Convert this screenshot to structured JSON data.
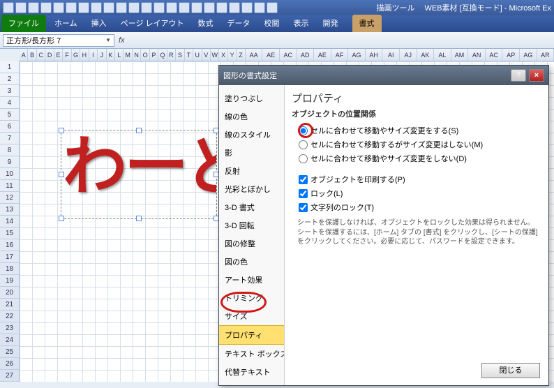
{
  "app": {
    "contextTool": "描画ツール",
    "docTitle": "WEB素材 [互換モード] - Microsoft Ex"
  },
  "tabs": {
    "file": "ファイル",
    "home": "ホーム",
    "insert": "挿入",
    "layout": "ページ レイアウト",
    "formula": "数式",
    "data": "データ",
    "review": "校閲",
    "view": "表示",
    "dev": "開発",
    "format": "書式"
  },
  "namebox": "正方形/長方形 7",
  "fx": "fx",
  "cols": [
    "A",
    "B",
    "C",
    "D",
    "E",
    "F",
    "G",
    "H",
    "I",
    "J",
    "K",
    "L",
    "M",
    "N",
    "O",
    "P",
    "Q",
    "R",
    "S",
    "T",
    "U",
    "V",
    "W",
    "X",
    "Y",
    "Z",
    "AA",
    "AE",
    "AC",
    "AD",
    "AE",
    "AF",
    "AG",
    "AH",
    "AI",
    "AJ",
    "AK",
    "AL",
    "AM",
    "AN",
    "AC",
    "AP",
    "AG",
    "AR"
  ],
  "shapeText": "わーど",
  "dialog": {
    "title": "図形の書式設定",
    "nav": [
      "塗りつぶし",
      "線の色",
      "線のスタイル",
      "影",
      "反射",
      "光彩とぼかし",
      "3-D 書式",
      "3-D 回転",
      "図の修整",
      "図の色",
      "アート効果",
      "トリミング",
      "サイズ",
      "プロパティ",
      "テキスト ボックス",
      "代替テキスト"
    ],
    "activeNav": 13,
    "heading": "プロパティ",
    "subheading": "オブジェクトの位置関係",
    "radios": [
      {
        "label": "セルに合わせて移動やサイズ変更をする(S)",
        "checked": true
      },
      {
        "label": "セルに合わせて移動するがサイズ変更はしない(M)",
        "checked": false
      },
      {
        "label": "セルに合わせて移動やサイズ変更をしない(D)",
        "checked": false
      }
    ],
    "checks": [
      {
        "label": "オブジェクトを印刷する(P)",
        "checked": true
      },
      {
        "label": "ロック(L)",
        "checked": true
      },
      {
        "label": "文字列のロック(T)",
        "checked": true
      }
    ],
    "help": "シートを保護しなければ、オブジェクトをロックした効果は得られません。シートを保護するには、[ホーム] タブの [書式] をクリックし、[シートの保護] をクリックしてください。必要に応じて、パスワードを設定できます。",
    "close": "閉じる"
  }
}
